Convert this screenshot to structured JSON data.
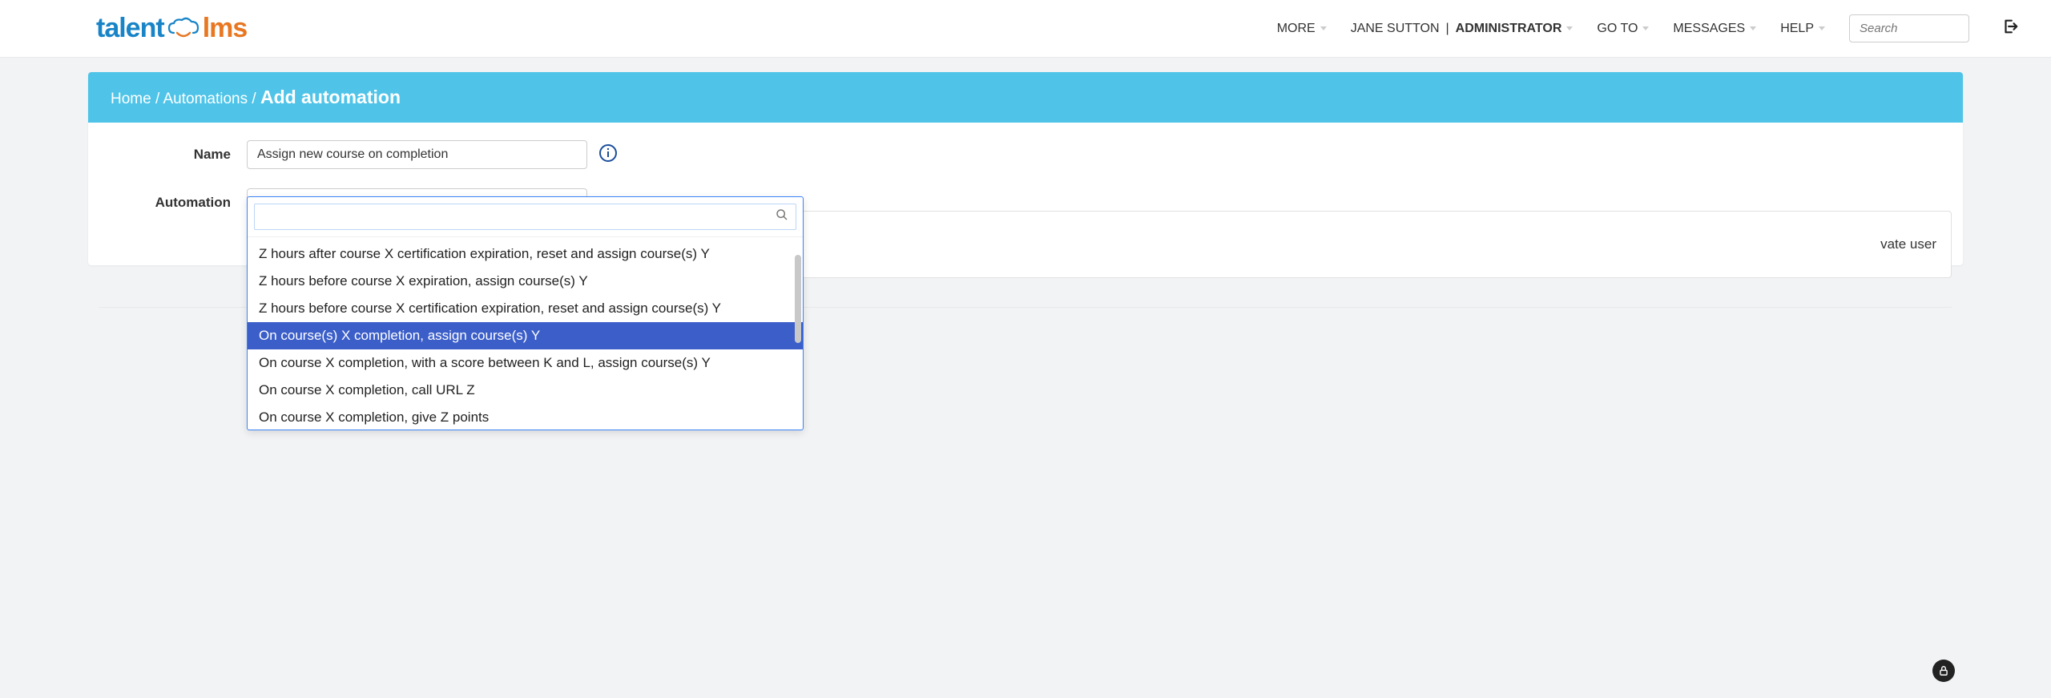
{
  "logo": {
    "part1": "talent",
    "part2": "lms"
  },
  "nav": {
    "more": "MORE",
    "user_name": "JANE SUTTON",
    "role": "ADMINISTRATOR",
    "goto": "GO TO",
    "messages": "MESSAGES",
    "help": "HELP",
    "search_placeholder": "Search"
  },
  "breadcrumb": {
    "home": "Home",
    "automations": "Automations",
    "current": "Add automation"
  },
  "form": {
    "name_label": "Name",
    "name_value": "Assign new course on completion",
    "automation_label": "Automation",
    "automation_selected": "On course(s) X completion, assign course(s) Y"
  },
  "behind_text": "vate user",
  "dropdown": {
    "items": [
      {
        "label": "Z hours after course X certification expiration, reset and assign course(s) Y",
        "selected": false
      },
      {
        "label": "Z hours before course X expiration, assign course(s) Y",
        "selected": false
      },
      {
        "label": "Z hours before course X certification expiration, reset and assign course(s) Y",
        "selected": false
      },
      {
        "label": "On course(s) X completion, assign course(s) Y",
        "selected": true
      },
      {
        "label": "On course X completion, with a score between K and L, assign course(s) Y",
        "selected": false
      },
      {
        "label": "On course X completion, call URL Z",
        "selected": false
      },
      {
        "label": "On course X completion, give Z points",
        "selected": false
      }
    ]
  }
}
